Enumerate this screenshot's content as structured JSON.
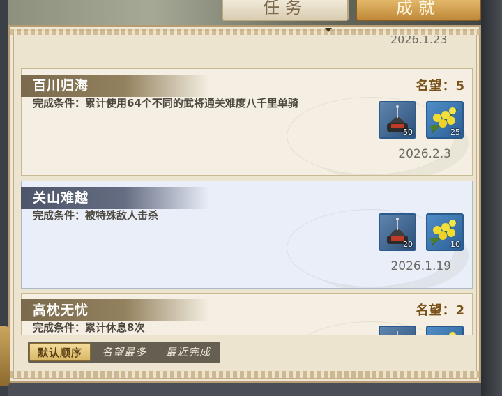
{
  "tabs": [
    {
      "label": "任务",
      "active": false
    },
    {
      "label": "成就",
      "active": true
    }
  ],
  "partial_prev_date": "2026.1.23",
  "achievements": [
    {
      "title": "百川归海",
      "fame": "名望：5",
      "condition": "完成条件：累计使用64个不同的武将通关难度八千里单骑",
      "rewards": [
        {
          "icon": "armor-helmet-icon",
          "count": "50"
        },
        {
          "icon": "yellow-flower-icon",
          "count": "25"
        }
      ],
      "date": "2026.2.3",
      "selected": false
    },
    {
      "title": "关山难越",
      "fame": "",
      "condition": "完成条件：被特殊敌人击杀",
      "rewards": [
        {
          "icon": "armor-helmet-icon",
          "count": "20"
        },
        {
          "icon": "yellow-flower-icon",
          "count": "10"
        }
      ],
      "date": "2026.1.19",
      "selected": true
    },
    {
      "title": "高枕无忧",
      "fame": "名望：2",
      "condition": "完成条件：累计休息8次",
      "rewards": [
        {
          "icon": "armor-helmet-icon",
          "count": ""
        },
        {
          "icon": "yellow-flower-icon",
          "count": ""
        }
      ],
      "date": "",
      "selected": false
    }
  ],
  "sort": {
    "default_label": "默认顺序",
    "fame_label": "名望最多",
    "recent_label": "最近完成"
  },
  "colors": {
    "fame_text": "#7a5018",
    "selected_card": "#e9eef8",
    "card": "#f4efe2",
    "active_tab": "#c08a3a"
  }
}
